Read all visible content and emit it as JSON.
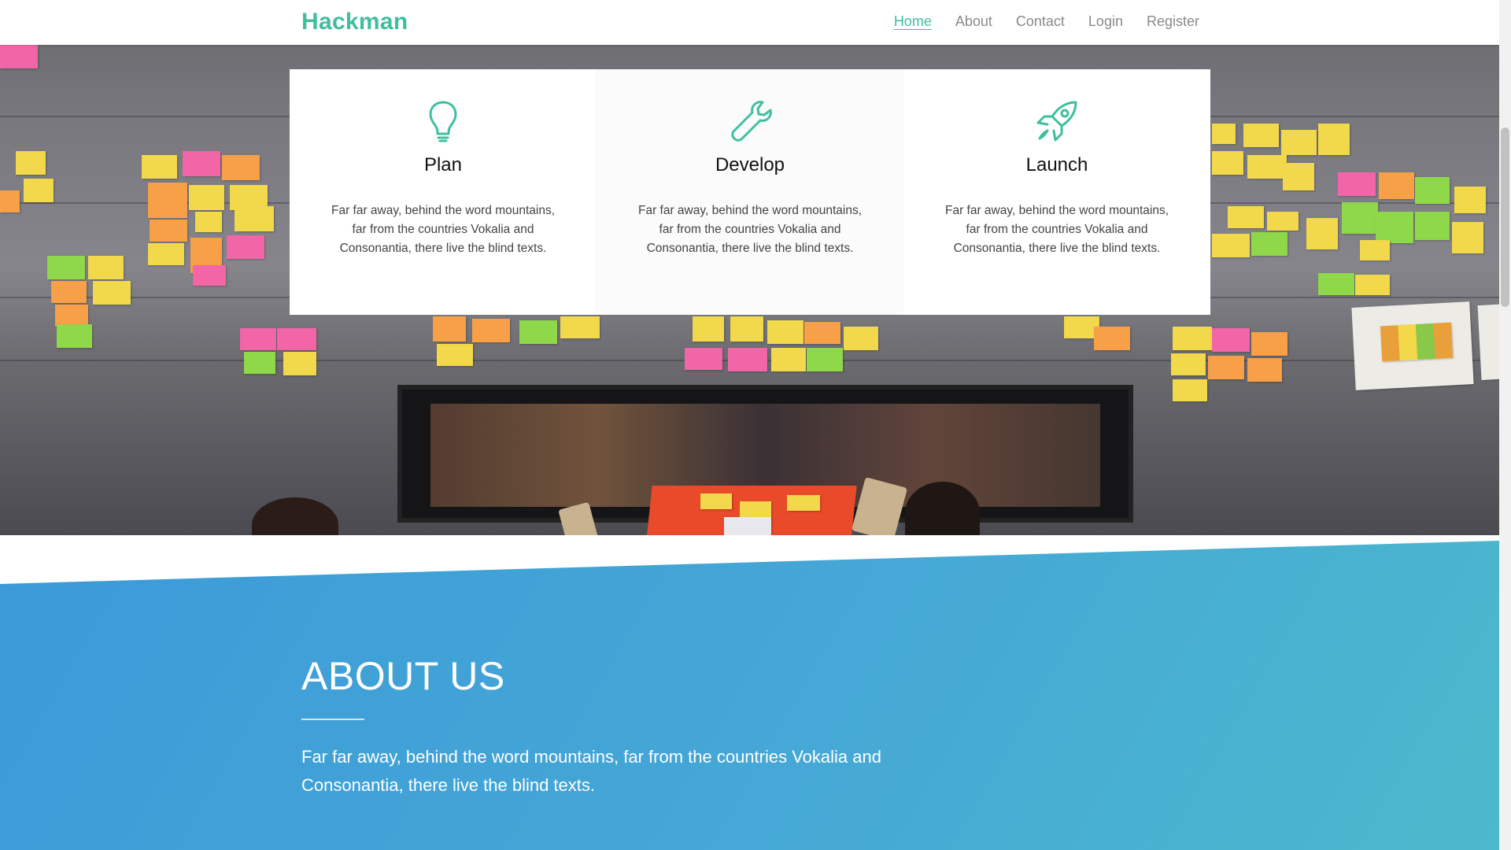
{
  "brand": {
    "name": "Hackman"
  },
  "nav": {
    "items": [
      {
        "label": "Home",
        "active": true
      },
      {
        "label": "About",
        "active": false
      },
      {
        "label": "Contact",
        "active": false
      },
      {
        "label": "Login",
        "active": false
      },
      {
        "label": "Register",
        "active": false
      }
    ]
  },
  "features": [
    {
      "icon": "lightbulb-icon",
      "title": "Plan",
      "text": "Far far away, behind the word mountains, far from the countries Vokalia and Consonantia, there live the blind texts."
    },
    {
      "icon": "wrench-icon",
      "title": "Develop",
      "text": "Far far away, behind the word mountains, far from the countries Vokalia and Consonantia, there live the blind texts."
    },
    {
      "icon": "rocket-icon",
      "title": "Launch",
      "text": "Far far away, behind the word mountains, far from the countries Vokalia and Consonantia, there live the blind texts."
    }
  ],
  "about": {
    "title": "ABOUT US",
    "text": "Far far away, behind the word mountains, far from the countries Vokalia and Consonantia, there live the blind texts."
  },
  "colors": {
    "accent": "#3fbf9f",
    "about_gradient_start": "#3c9ad8",
    "about_gradient_end": "#4cb9cc"
  }
}
